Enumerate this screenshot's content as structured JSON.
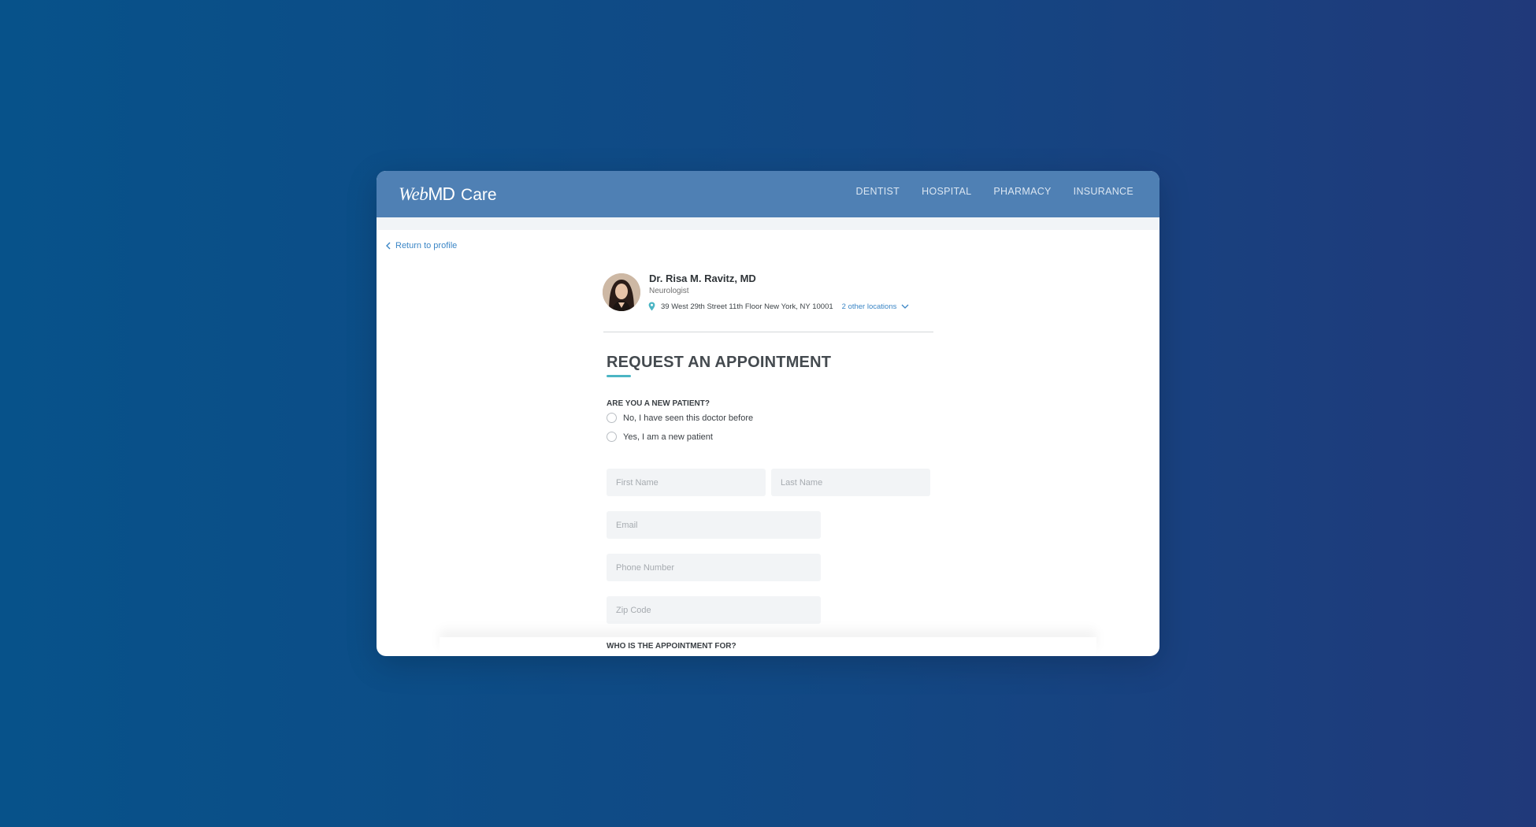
{
  "brand": {
    "name_italic": "Web",
    "name_bold": "MD",
    "product": "Care"
  },
  "nav": {
    "items": [
      "DENTIST",
      "HOSPITAL",
      "PHARMACY",
      "INSURANCE"
    ]
  },
  "back": {
    "label": "Return to profile"
  },
  "doctor": {
    "name": "Dr. Risa M. Ravitz, MD",
    "specialty": "Neurologist",
    "address": "39 West 29th Street 11th Floor New York, NY 10001",
    "other_locations": "2 other locations"
  },
  "form": {
    "title": "REQUEST AN APPOINTMENT",
    "new_patient_question": "ARE YOU A NEW PATIENT?",
    "options": [
      "No, I have seen this doctor before",
      "Yes, I am a new patient"
    ],
    "fields": {
      "first_name": {
        "placeholder": "First Name",
        "value": ""
      },
      "last_name": {
        "placeholder": "Last Name",
        "value": ""
      },
      "email": {
        "placeholder": "Email",
        "value": ""
      },
      "phone": {
        "placeholder": "Phone Number",
        "value": ""
      },
      "zip": {
        "placeholder": "Zip Code",
        "value": ""
      }
    },
    "appointment_for_question": "WHO IS THE APPOINTMENT FOR?"
  },
  "colors": {
    "header": "#4f80b4",
    "accent": "#4bb5c4",
    "link": "#3b86c6"
  }
}
